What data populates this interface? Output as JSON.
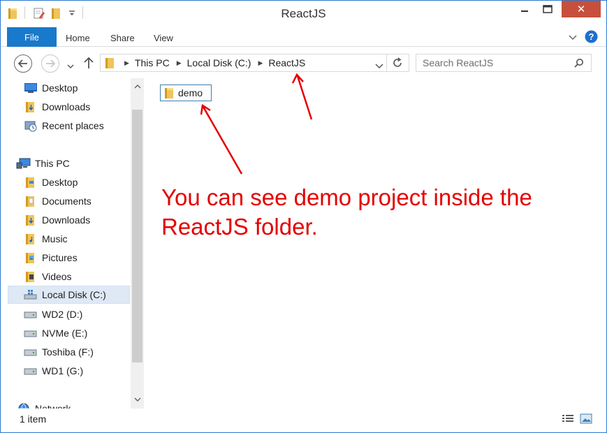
{
  "window": {
    "title": "ReactJS",
    "close_label": "✕"
  },
  "ribbon": {
    "tabs": [
      "File",
      "Home",
      "Share",
      "View"
    ]
  },
  "address": {
    "crumbs": [
      "This PC",
      "Local Disk (C:)",
      "ReactJS"
    ]
  },
  "search": {
    "placeholder": "Search ReactJS"
  },
  "navigation": {
    "favorites": [
      "Desktop",
      "Downloads",
      "Recent places"
    ],
    "this_pc": "This PC",
    "pc_items": [
      "Desktop",
      "Documents",
      "Downloads",
      "Music",
      "Pictures",
      "Videos",
      "Local Disk (C:)",
      "WD2 (D:)",
      "NVMe (E:)",
      "Toshiba (F:)",
      "WD1 (G:)"
    ],
    "network": "Network"
  },
  "content": {
    "items": [
      {
        "name": "demo"
      }
    ]
  },
  "annotation": {
    "text": "You can see demo project inside the ReactJS folder."
  },
  "status": {
    "item_count": "1 item"
  },
  "colors": {
    "accent": "#1979ca",
    "annotation": "#e40000",
    "folder": "#e8b94a",
    "close": "#c74f3c"
  }
}
